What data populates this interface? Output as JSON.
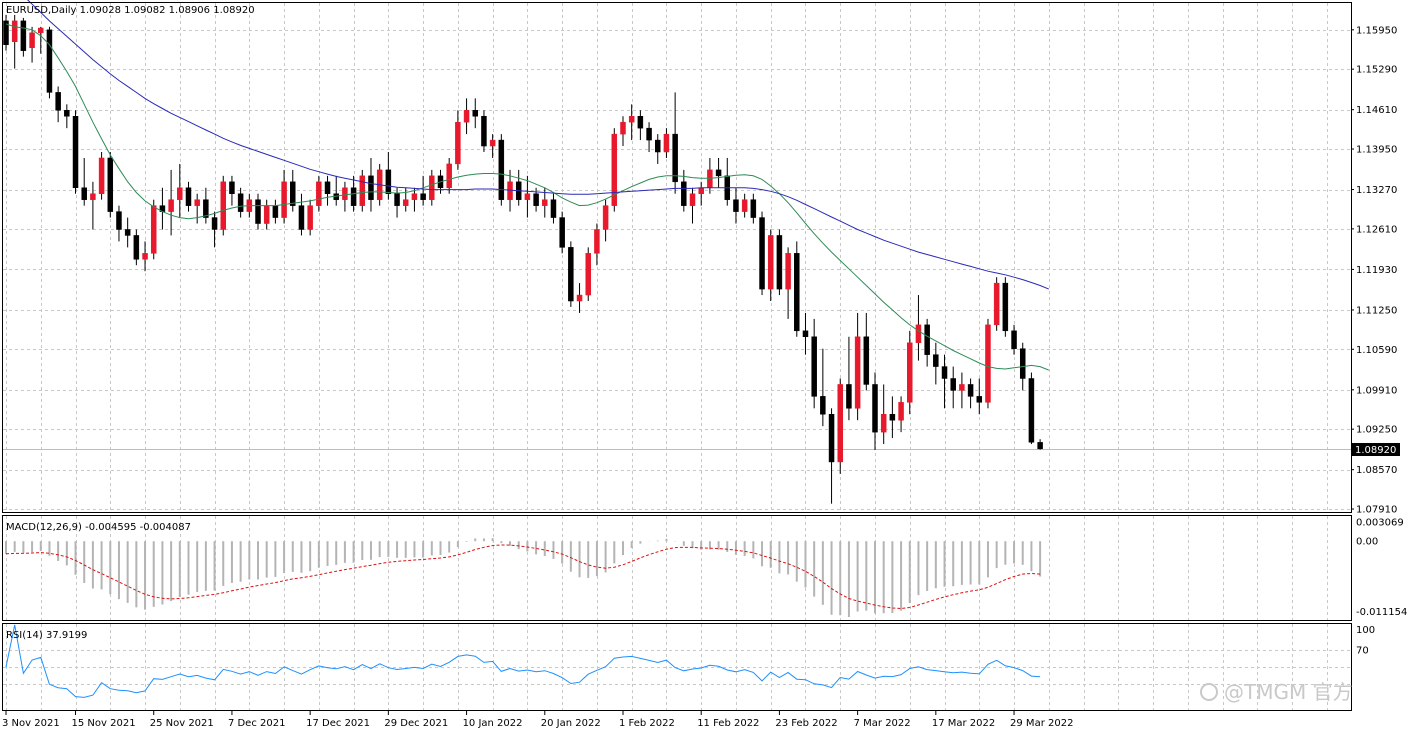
{
  "chart_data": {
    "type": "candlestick",
    "symbol_header": "EURUSD,Daily  1.09028 1.09082 1.08906 1.08920",
    "current_price": "1.08920",
    "price_axis_ticks": [
      "1.15950",
      "1.15290",
      "1.14610",
      "1.13950",
      "1.13270",
      "1.12610",
      "1.11930",
      "1.11250",
      "1.10590",
      "1.09910",
      "1.09250",
      "1.08570",
      "1.07910"
    ],
    "price_range": [
      1.0786,
      1.164
    ],
    "date_labels": [
      "3 Nov 2021",
      "15 Nov 2021",
      "25 Nov 2021",
      "7 Dec 2021",
      "17 Dec 2021",
      "29 Dec 2021",
      "10 Jan 2022",
      "20 Jan 2022",
      "1 Feb 2022",
      "11 Feb 2022",
      "23 Feb 2022",
      "7 Mar 2022",
      "17 Mar 2022",
      "29 Mar 2022"
    ],
    "date_label_bar_index": [
      0,
      8,
      17,
      26,
      35,
      44,
      53,
      62,
      71,
      80,
      89,
      98,
      107,
      116
    ],
    "candles": [
      [
        1.161,
        1.162,
        1.156,
        1.157
      ],
      [
        1.1575,
        1.162,
        1.153,
        1.161
      ],
      [
        1.161,
        1.1615,
        1.155,
        1.156
      ],
      [
        1.1565,
        1.16,
        1.154,
        1.159
      ],
      [
        1.159,
        1.16,
        1.1555,
        1.1598
      ],
      [
        1.1595,
        1.16,
        1.148,
        1.149
      ],
      [
        1.149,
        1.15,
        1.144,
        1.146
      ],
      [
        1.146,
        1.147,
        1.143,
        1.145
      ],
      [
        1.145,
        1.146,
        1.132,
        1.133
      ],
      [
        1.133,
        1.138,
        1.13,
        1.131
      ],
      [
        1.131,
        1.134,
        1.126,
        1.132
      ],
      [
        1.132,
        1.139,
        1.131,
        1.138
      ],
      [
        1.138,
        1.139,
        1.128,
        1.129
      ],
      [
        1.129,
        1.13,
        1.124,
        1.126
      ],
      [
        1.126,
        1.128,
        1.123,
        1.125
      ],
      [
        1.125,
        1.126,
        1.12,
        1.121
      ],
      [
        1.121,
        1.124,
        1.119,
        1.122
      ],
      [
        1.122,
        1.131,
        1.121,
        1.13
      ],
      [
        1.13,
        1.133,
        1.126,
        1.129
      ],
      [
        1.129,
        1.136,
        1.125,
        1.131
      ],
      [
        1.131,
        1.137,
        1.128,
        1.133
      ],
      [
        1.133,
        1.134,
        1.129,
        1.13
      ],
      [
        1.13,
        1.132,
        1.127,
        1.131
      ],
      [
        1.131,
        1.133,
        1.127,
        1.128
      ],
      [
        1.128,
        1.129,
        1.123,
        1.126
      ],
      [
        1.126,
        1.135,
        1.125,
        1.134
      ],
      [
        1.134,
        1.135,
        1.13,
        1.132
      ],
      [
        1.132,
        1.133,
        1.128,
        1.129
      ],
      [
        1.129,
        1.132,
        1.128,
        1.131
      ],
      [
        1.131,
        1.132,
        1.126,
        1.127
      ],
      [
        1.127,
        1.131,
        1.126,
        1.13
      ],
      [
        1.13,
        1.131,
        1.127,
        1.128
      ],
      [
        1.128,
        1.136,
        1.127,
        1.134
      ],
      [
        1.134,
        1.136,
        1.129,
        1.13
      ],
      [
        1.13,
        1.132,
        1.125,
        1.126
      ],
      [
        1.126,
        1.131,
        1.125,
        1.13
      ],
      [
        1.13,
        1.135,
        1.129,
        1.134
      ],
      [
        1.134,
        1.135,
        1.13,
        1.132
      ],
      [
        1.132,
        1.135,
        1.13,
        1.131
      ],
      [
        1.131,
        1.134,
        1.129,
        1.133
      ],
      [
        1.133,
        1.135,
        1.129,
        1.13
      ],
      [
        1.13,
        1.136,
        1.129,
        1.135
      ],
      [
        1.135,
        1.138,
        1.129,
        1.131
      ],
      [
        1.131,
        1.137,
        1.13,
        1.136
      ],
      [
        1.136,
        1.139,
        1.131,
        1.132
      ],
      [
        1.132,
        1.133,
        1.128,
        1.13
      ],
      [
        1.13,
        1.133,
        1.129,
        1.131
      ],
      [
        1.131,
        1.133,
        1.129,
        1.132
      ],
      [
        1.132,
        1.135,
        1.13,
        1.131
      ],
      [
        1.131,
        1.136,
        1.13,
        1.135
      ],
      [
        1.135,
        1.136,
        1.132,
        1.133
      ],
      [
        1.133,
        1.138,
        1.132,
        1.137
      ],
      [
        1.137,
        1.146,
        1.136,
        1.144
      ],
      [
        1.144,
        1.148,
        1.142,
        1.146
      ],
      [
        1.146,
        1.148,
        1.143,
        1.145
      ],
      [
        1.145,
        1.146,
        1.139,
        1.14
      ],
      [
        1.14,
        1.142,
        1.138,
        1.141
      ],
      [
        1.141,
        1.142,
        1.13,
        1.131
      ],
      [
        1.131,
        1.136,
        1.129,
        1.134
      ],
      [
        1.134,
        1.136,
        1.13,
        1.131
      ],
      [
        1.131,
        1.135,
        1.128,
        1.132
      ],
      [
        1.132,
        1.133,
        1.129,
        1.13
      ],
      [
        1.13,
        1.133,
        1.128,
        1.131
      ],
      [
        1.131,
        1.132,
        1.127,
        1.128
      ],
      [
        1.128,
        1.129,
        1.122,
        1.123
      ],
      [
        1.123,
        1.124,
        1.113,
        1.114
      ],
      [
        1.114,
        1.117,
        1.112,
        1.115
      ],
      [
        1.115,
        1.123,
        1.114,
        1.122
      ],
      [
        1.122,
        1.127,
        1.12,
        1.126
      ],
      [
        1.126,
        1.131,
        1.124,
        1.13
      ],
      [
        1.13,
        1.143,
        1.129,
        1.142
      ],
      [
        1.142,
        1.145,
        1.14,
        1.144
      ],
      [
        1.144,
        1.147,
        1.141,
        1.145
      ],
      [
        1.145,
        1.146,
        1.141,
        1.143
      ],
      [
        1.143,
        1.144,
        1.139,
        1.141
      ],
      [
        1.141,
        1.142,
        1.137,
        1.139
      ],
      [
        1.139,
        1.143,
        1.138,
        1.142
      ],
      [
        1.142,
        1.149,
        1.132,
        1.134
      ],
      [
        1.134,
        1.136,
        1.129,
        1.13
      ],
      [
        1.13,
        1.133,
        1.127,
        1.132
      ],
      [
        1.132,
        1.134,
        1.13,
        1.133
      ],
      [
        1.133,
        1.138,
        1.132,
        1.136
      ],
      [
        1.136,
        1.138,
        1.133,
        1.135
      ],
      [
        1.135,
        1.138,
        1.13,
        1.131
      ],
      [
        1.131,
        1.133,
        1.127,
        1.129
      ],
      [
        1.129,
        1.132,
        1.128,
        1.131
      ],
      [
        1.131,
        1.132,
        1.127,
        1.128
      ],
      [
        1.128,
        1.129,
        1.115,
        1.116
      ],
      [
        1.116,
        1.126,
        1.114,
        1.125
      ],
      [
        1.125,
        1.126,
        1.115,
        1.116
      ],
      [
        1.116,
        1.123,
        1.111,
        1.122
      ],
      [
        1.122,
        1.124,
        1.108,
        1.109
      ],
      [
        1.109,
        1.112,
        1.105,
        1.108
      ],
      [
        1.108,
        1.111,
        1.096,
        1.098
      ],
      [
        1.098,
        1.106,
        1.093,
        1.095
      ],
      [
        1.095,
        1.096,
        1.08,
        1.087
      ],
      [
        1.087,
        1.101,
        1.085,
        1.1
      ],
      [
        1.1,
        1.108,
        1.094,
        1.096
      ],
      [
        1.096,
        1.112,
        1.094,
        1.108
      ],
      [
        1.108,
        1.112,
        1.099,
        1.1
      ],
      [
        1.1,
        1.102,
        1.089,
        1.092
      ],
      [
        1.092,
        1.1,
        1.09,
        1.095
      ],
      [
        1.095,
        1.098,
        1.091,
        1.094
      ],
      [
        1.094,
        1.098,
        1.092,
        1.097
      ],
      [
        1.097,
        1.109,
        1.095,
        1.107
      ],
      [
        1.107,
        1.115,
        1.104,
        1.11
      ],
      [
        1.11,
        1.111,
        1.103,
        1.105
      ],
      [
        1.105,
        1.107,
        1.1,
        1.103
      ],
      [
        1.103,
        1.105,
        1.096,
        1.101
      ],
      [
        1.101,
        1.103,
        1.096,
        1.099
      ],
      [
        1.099,
        1.102,
        1.096,
        1.1
      ],
      [
        1.1,
        1.101,
        1.096,
        1.098
      ],
      [
        1.098,
        1.101,
        1.095,
        1.097
      ],
      [
        1.097,
        1.111,
        1.096,
        1.11
      ],
      [
        1.11,
        1.118,
        1.109,
        1.117
      ],
      [
        1.117,
        1.118,
        1.108,
        1.109
      ],
      [
        1.109,
        1.11,
        1.105,
        1.106
      ],
      [
        1.106,
        1.107,
        1.099,
        1.101
      ],
      [
        1.101,
        1.102,
        1.09,
        1.0903
      ],
      [
        1.09028,
        1.09082,
        1.08906,
        1.0892
      ]
    ],
    "ma_fast": [
      1.1605,
      1.16,
      1.1598,
      1.1595,
      1.1585,
      1.157,
      1.1548,
      1.1525,
      1.15,
      1.147,
      1.144,
      1.1412,
      1.1385,
      1.1362,
      1.134,
      1.1322,
      1.1308,
      1.1298,
      1.129,
      1.1284,
      1.128,
      1.1278,
      1.128,
      1.1283,
      1.1287,
      1.1292,
      1.1296,
      1.1299,
      1.13,
      1.13,
      1.13,
      1.13,
      1.1302,
      1.1304,
      1.1306,
      1.1308,
      1.1311,
      1.1314,
      1.1316,
      1.1318,
      1.132,
      1.1322,
      1.1323,
      1.1323,
      1.1322,
      1.1321,
      1.1322,
      1.1325,
      1.133,
      1.1335,
      1.134,
      1.1344,
      1.1348,
      1.1351,
      1.1353,
      1.1354,
      1.1354,
      1.1353,
      1.135,
      1.1346,
      1.1342,
      1.1336,
      1.133,
      1.1322,
      1.1313,
      1.1306,
      1.13,
      1.1301,
      1.1305,
      1.1311,
      1.1318,
      1.1325,
      1.1332,
      1.1338,
      1.1344,
      1.1348,
      1.135,
      1.135,
      1.1349,
      1.1347,
      1.1346,
      1.1346,
      1.1347,
      1.1349,
      1.1351,
      1.1352,
      1.135,
      1.1344,
      1.1333,
      1.132,
      1.1305,
      1.1288,
      1.127,
      1.1253,
      1.1237,
      1.1222,
      1.1208,
      1.1194,
      1.118,
      1.1166,
      1.1152,
      1.1138,
      1.1125,
      1.1112,
      1.11,
      1.109,
      1.1081,
      1.1073,
      1.1065,
      1.1057,
      1.105,
      1.1043,
      1.1036,
      1.103,
      1.1027,
      1.1026,
      1.1028,
      1.103,
      1.1032,
      1.103,
      1.1024
    ],
    "ma_slow": [
      1.168,
      1.1666,
      1.1652,
      1.1638,
      1.1624,
      1.161,
      1.1597,
      1.1584,
      1.1571,
      1.1558,
      1.1545,
      1.1533,
      1.1521,
      1.151,
      1.15,
      1.149,
      1.148,
      1.1471,
      1.1463,
      1.1455,
      1.1448,
      1.1441,
      1.1434,
      1.1427,
      1.142,
      1.1413,
      1.1407,
      1.1401,
      1.1396,
      1.1391,
      1.1386,
      1.1381,
      1.1376,
      1.1371,
      1.1366,
      1.1361,
      1.1357,
      1.1353,
      1.1349,
      1.1346,
      1.1343,
      1.134,
      1.1337,
      1.1335,
      1.1333,
      1.1331,
      1.133,
      1.1329,
      1.1328,
      1.1327,
      1.1327,
      1.1327,
      1.1327,
      1.1327,
      1.1328,
      1.1328,
      1.1328,
      1.1327,
      1.1326,
      1.1325,
      1.1324,
      1.1323,
      1.1322,
      1.1321,
      1.132,
      1.1319,
      1.1319,
      1.1319,
      1.132,
      1.1321,
      1.1322,
      1.1323,
      1.1324,
      1.1325,
      1.1326,
      1.1327,
      1.1328,
      1.1329,
      1.1329,
      1.1329,
      1.133,
      1.133,
      1.133,
      1.133,
      1.133,
      1.133,
      1.1329,
      1.1327,
      1.1324,
      1.132,
      1.1315,
      1.1309,
      1.1302,
      1.1295,
      1.1288,
      1.1281,
      1.1274,
      1.1267,
      1.126,
      1.1254,
      1.1248,
      1.1242,
      1.1237,
      1.1232,
      1.1227,
      1.1222,
      1.1218,
      1.1214,
      1.121,
      1.1206,
      1.1202,
      1.1198,
      1.1194,
      1.119,
      1.1187,
      1.1184,
      1.118,
      1.1176,
      1.1171,
      1.1166,
      1.116
    ],
    "ma_fast_color": "#2e8b57",
    "ma_slow_color": "#2a2ab8",
    "bull_color": "#e8192c",
    "bear_color": "#000000",
    "macd": {
      "label": "MACD(12,26,9) -0.004595 -0.004087",
      "axis_ticks": [
        "0.003069",
        "0.00",
        "-0.011154"
      ],
      "range": [
        -0.0125,
        0.004
      ],
      "histogram_color": "#b4b4b4",
      "signal_color": "#dd1111"
    },
    "rsi": {
      "label": "RSI(14) 37.9199",
      "axis_ticks": [
        "100",
        "70"
      ],
      "range": [
        0,
        100
      ],
      "line_color": "#1e90ff"
    }
  },
  "watermark": "@TMGM 官方",
  "watermark_icon": "weibo-like-icon"
}
